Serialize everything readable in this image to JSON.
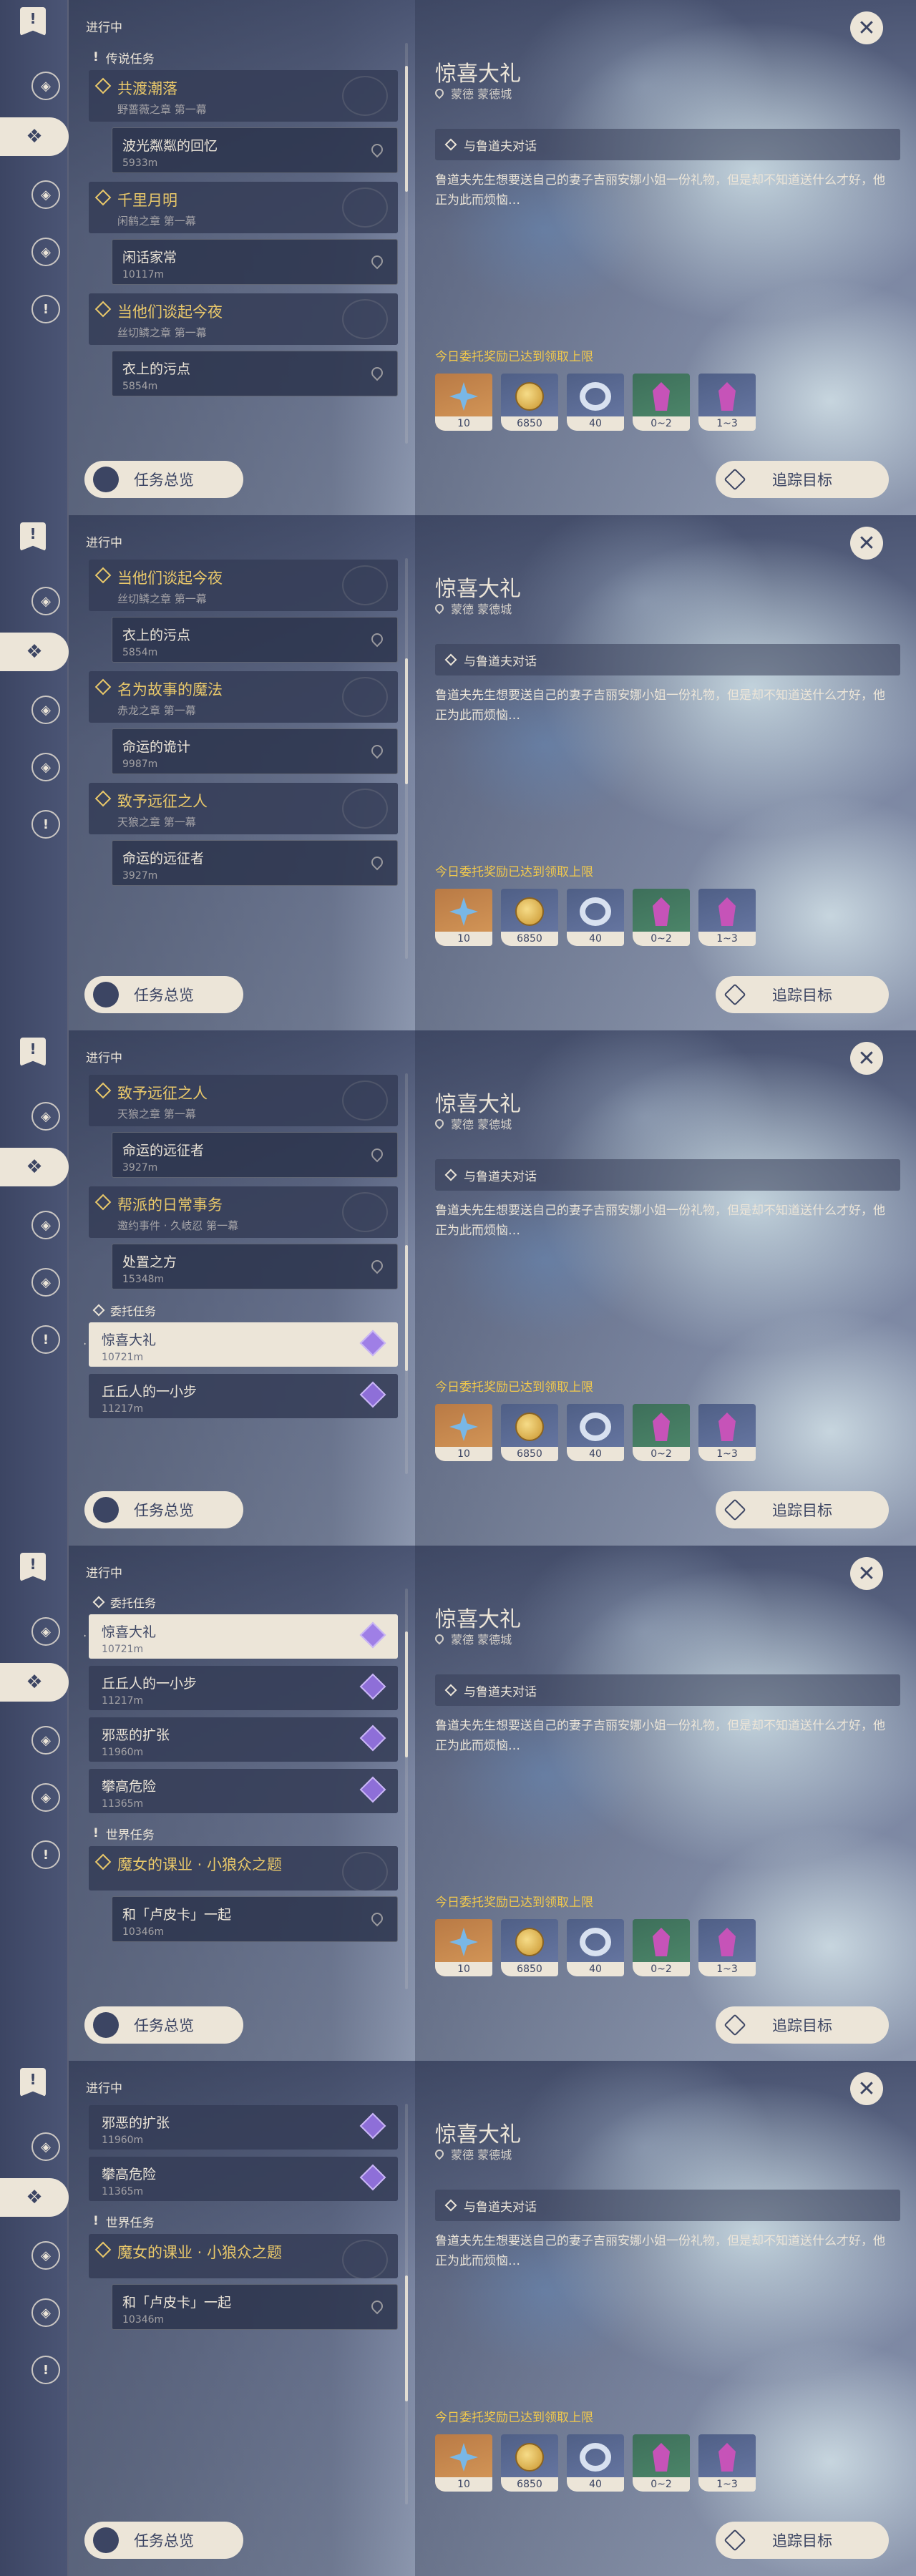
{
  "sidebar": {
    "items": [
      {
        "icon": "legend-quest-icon"
      },
      {
        "icon": "daily-commission-icon"
      },
      {
        "icon": "archon-quest-icon"
      },
      {
        "icon": "story-quest-icon"
      },
      {
        "icon": "world-quest-icon"
      }
    ]
  },
  "header": {
    "status_label": "进行中"
  },
  "detail": {
    "title": "惊喜大礼",
    "location": "蒙德 蒙德城",
    "objective": "与鲁道夫对话",
    "description": "鲁道夫先生想要送自己的妻子吉丽安娜小姐一份礼物，但是却不知道送什么才好，他正为此而烦恼…",
    "reward_notice": "今日委托奖励已达到领取上限",
    "rewards": [
      {
        "icon": "adventure-exp-icon",
        "count": "10",
        "color": "orange"
      },
      {
        "icon": "mora-icon",
        "count": "6850",
        "color": "blue"
      },
      {
        "icon": "friendship-exp-icon",
        "count": "40",
        "color": "blue"
      },
      {
        "icon": "crystal-green-icon",
        "count": "0~2",
        "color": "green"
      },
      {
        "icon": "crystal-blue-icon",
        "count": "1~3",
        "color": "blue"
      }
    ]
  },
  "buttons": {
    "overview": "任务总览",
    "track": "追踪目标"
  },
  "screens": [
    {
      "rows": [
        {
          "kind": "section",
          "label": "传说任务",
          "icon": "excl"
        },
        {
          "kind": "quest",
          "title": "共渡潮落",
          "sub": "野蔷薇之章 第一幕",
          "style": "gold"
        },
        {
          "kind": "sub",
          "title": "波光粼粼的回忆",
          "dist": "5933m"
        },
        {
          "kind": "quest",
          "title": "千里月明",
          "sub": "闲鹤之章 第一幕",
          "style": "gold"
        },
        {
          "kind": "sub",
          "title": "闲话家常",
          "dist": "10117m"
        },
        {
          "kind": "quest",
          "title": "当他们谈起今夜",
          "sub": "丝切鳞之章 第一幕",
          "style": "gold"
        },
        {
          "kind": "sub",
          "title": "衣上的污点",
          "dist": "5854m"
        }
      ]
    },
    {
      "rows": [
        {
          "kind": "quest",
          "title": "当他们谈起今夜",
          "sub": "丝切鳞之章 第一幕",
          "style": "gold"
        },
        {
          "kind": "sub",
          "title": "衣上的污点",
          "dist": "5854m"
        },
        {
          "kind": "quest",
          "title": "名为故事的魔法",
          "sub": "赤龙之章 第一幕",
          "style": "gold"
        },
        {
          "kind": "sub",
          "title": "命运的诡计",
          "dist": "9987m"
        },
        {
          "kind": "quest",
          "title": "致予远征之人",
          "sub": "天狼之章 第一幕",
          "style": "gold"
        },
        {
          "kind": "sub",
          "title": "命运的远征者",
          "dist": "3927m"
        }
      ]
    },
    {
      "rows": [
        {
          "kind": "quest",
          "title": "致予远征之人",
          "sub": "天狼之章 第一幕",
          "style": "gold"
        },
        {
          "kind": "sub",
          "title": "命运的远征者",
          "dist": "3927m"
        },
        {
          "kind": "quest",
          "title": "帮派的日常事务",
          "sub": "邀约事件 · 久岐忍 第一幕",
          "style": "gold"
        },
        {
          "kind": "sub",
          "title": "处置之方",
          "dist": "15348m"
        },
        {
          "kind": "divider",
          "label": "委托任务"
        },
        {
          "kind": "commission",
          "title": "惊喜大礼",
          "dist": "10721m",
          "active": true
        },
        {
          "kind": "commission",
          "title": "丘丘人的一小步",
          "dist": "11217m",
          "active": false
        }
      ]
    },
    {
      "rows": [
        {
          "kind": "divider",
          "label": "委托任务"
        },
        {
          "kind": "commission",
          "title": "惊喜大礼",
          "dist": "10721m",
          "active": true
        },
        {
          "kind": "commission",
          "title": "丘丘人的一小步",
          "dist": "11217m",
          "active": false
        },
        {
          "kind": "commission",
          "title": "邪恶的扩张",
          "dist": "11960m",
          "active": false
        },
        {
          "kind": "commission",
          "title": "攀高危险",
          "dist": "11365m",
          "active": false
        },
        {
          "kind": "section",
          "label": "世界任务",
          "icon": "excl"
        },
        {
          "kind": "quest",
          "title": "魔女的课业 · 小狼众之题",
          "sub": "",
          "style": "gold-short"
        },
        {
          "kind": "sub",
          "title": "和「卢皮卡」一起",
          "dist": "10346m"
        }
      ]
    },
    {
      "rows": [
        {
          "kind": "commission",
          "title": "邪恶的扩张",
          "dist": "11960m",
          "active": false
        },
        {
          "kind": "commission",
          "title": "攀高危险",
          "dist": "11365m",
          "active": false
        },
        {
          "kind": "section",
          "label": "世界任务",
          "icon": "excl"
        },
        {
          "kind": "quest",
          "title": "魔女的课业 · 小狼众之题",
          "sub": "",
          "style": "gold-short"
        },
        {
          "kind": "sub",
          "title": "和「卢皮卡」一起",
          "dist": "10346m"
        }
      ]
    }
  ]
}
